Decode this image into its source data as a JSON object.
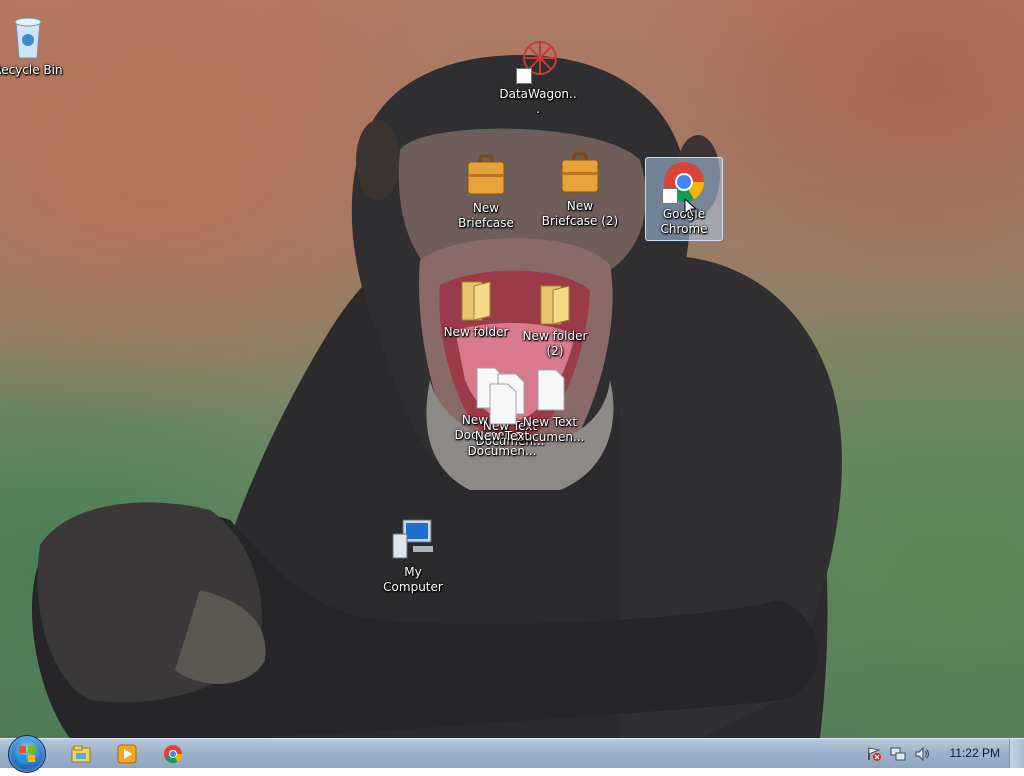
{
  "desktop": {
    "icons": {
      "recycle_bin": "Recycle Bin",
      "datawagon": "DataWagon...",
      "new_briefcase": "New Briefcase",
      "new_briefcase_2": "New Briefcase (2)",
      "google_chrome": "Google Chrome",
      "new_folder": "New folder",
      "new_folder_2": "New folder (2)",
      "new_text_doc_a": "New Text Documen...",
      "new_text_doc_b": "New Text Documen...",
      "new_text_doc_c": "New Text Documen...",
      "new_text_doc_d": "New Text Documen...",
      "my_computer": "My Computer"
    },
    "selected_icon": "Google Chrome"
  },
  "taskbar": {
    "pinned": [
      "windows-explorer-icon",
      "media-player-icon",
      "chrome-icon"
    ],
    "tray_icons": [
      "action-center-icon",
      "network-icon",
      "volume-icon"
    ],
    "clock": "11:22 PM"
  },
  "colors": {
    "taskbar": "#9fb3cb",
    "selection": "#aac8eb",
    "label_text": "#ffffff"
  }
}
